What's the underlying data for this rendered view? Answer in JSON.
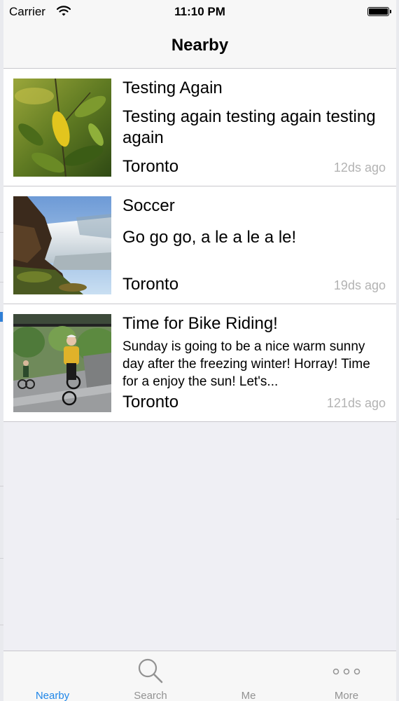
{
  "status_bar": {
    "carrier": "Carrier",
    "time": "11:10 PM"
  },
  "nav": {
    "title": "Nearby"
  },
  "posts": [
    {
      "title": "Testing Again",
      "body": "Testing again testing again testing again",
      "location": "Toronto",
      "time_ago": "12ds ago",
      "image": "leaves-photo"
    },
    {
      "title": "Soccer",
      "body": "Go go go, a le a le a le!",
      "location": "Toronto",
      "time_ago": "19ds ago",
      "image": "waterfall-photo"
    },
    {
      "title": "Time for Bike Riding!",
      "body": "Sunday is going to be a nice warm sunny day after the freezing winter! Horray! Time for a enjoy the sun! Let's...",
      "location": "Toronto",
      "time_ago": "121ds ago",
      "image": "cyclists-photo"
    }
  ],
  "tabs": [
    {
      "label": "Nearby",
      "icon": "nearby-icon",
      "active": true
    },
    {
      "label": "Search",
      "icon": "search-icon",
      "active": false
    },
    {
      "label": "Me",
      "icon": "me-icon",
      "active": false
    },
    {
      "label": "More",
      "icon": "more-icon",
      "active": false
    }
  ],
  "colors": {
    "active_tint": "#1f86e8",
    "inactive_tint": "#929292",
    "separator": "#c8c7cc",
    "time_ago": "#b3b3b3"
  }
}
